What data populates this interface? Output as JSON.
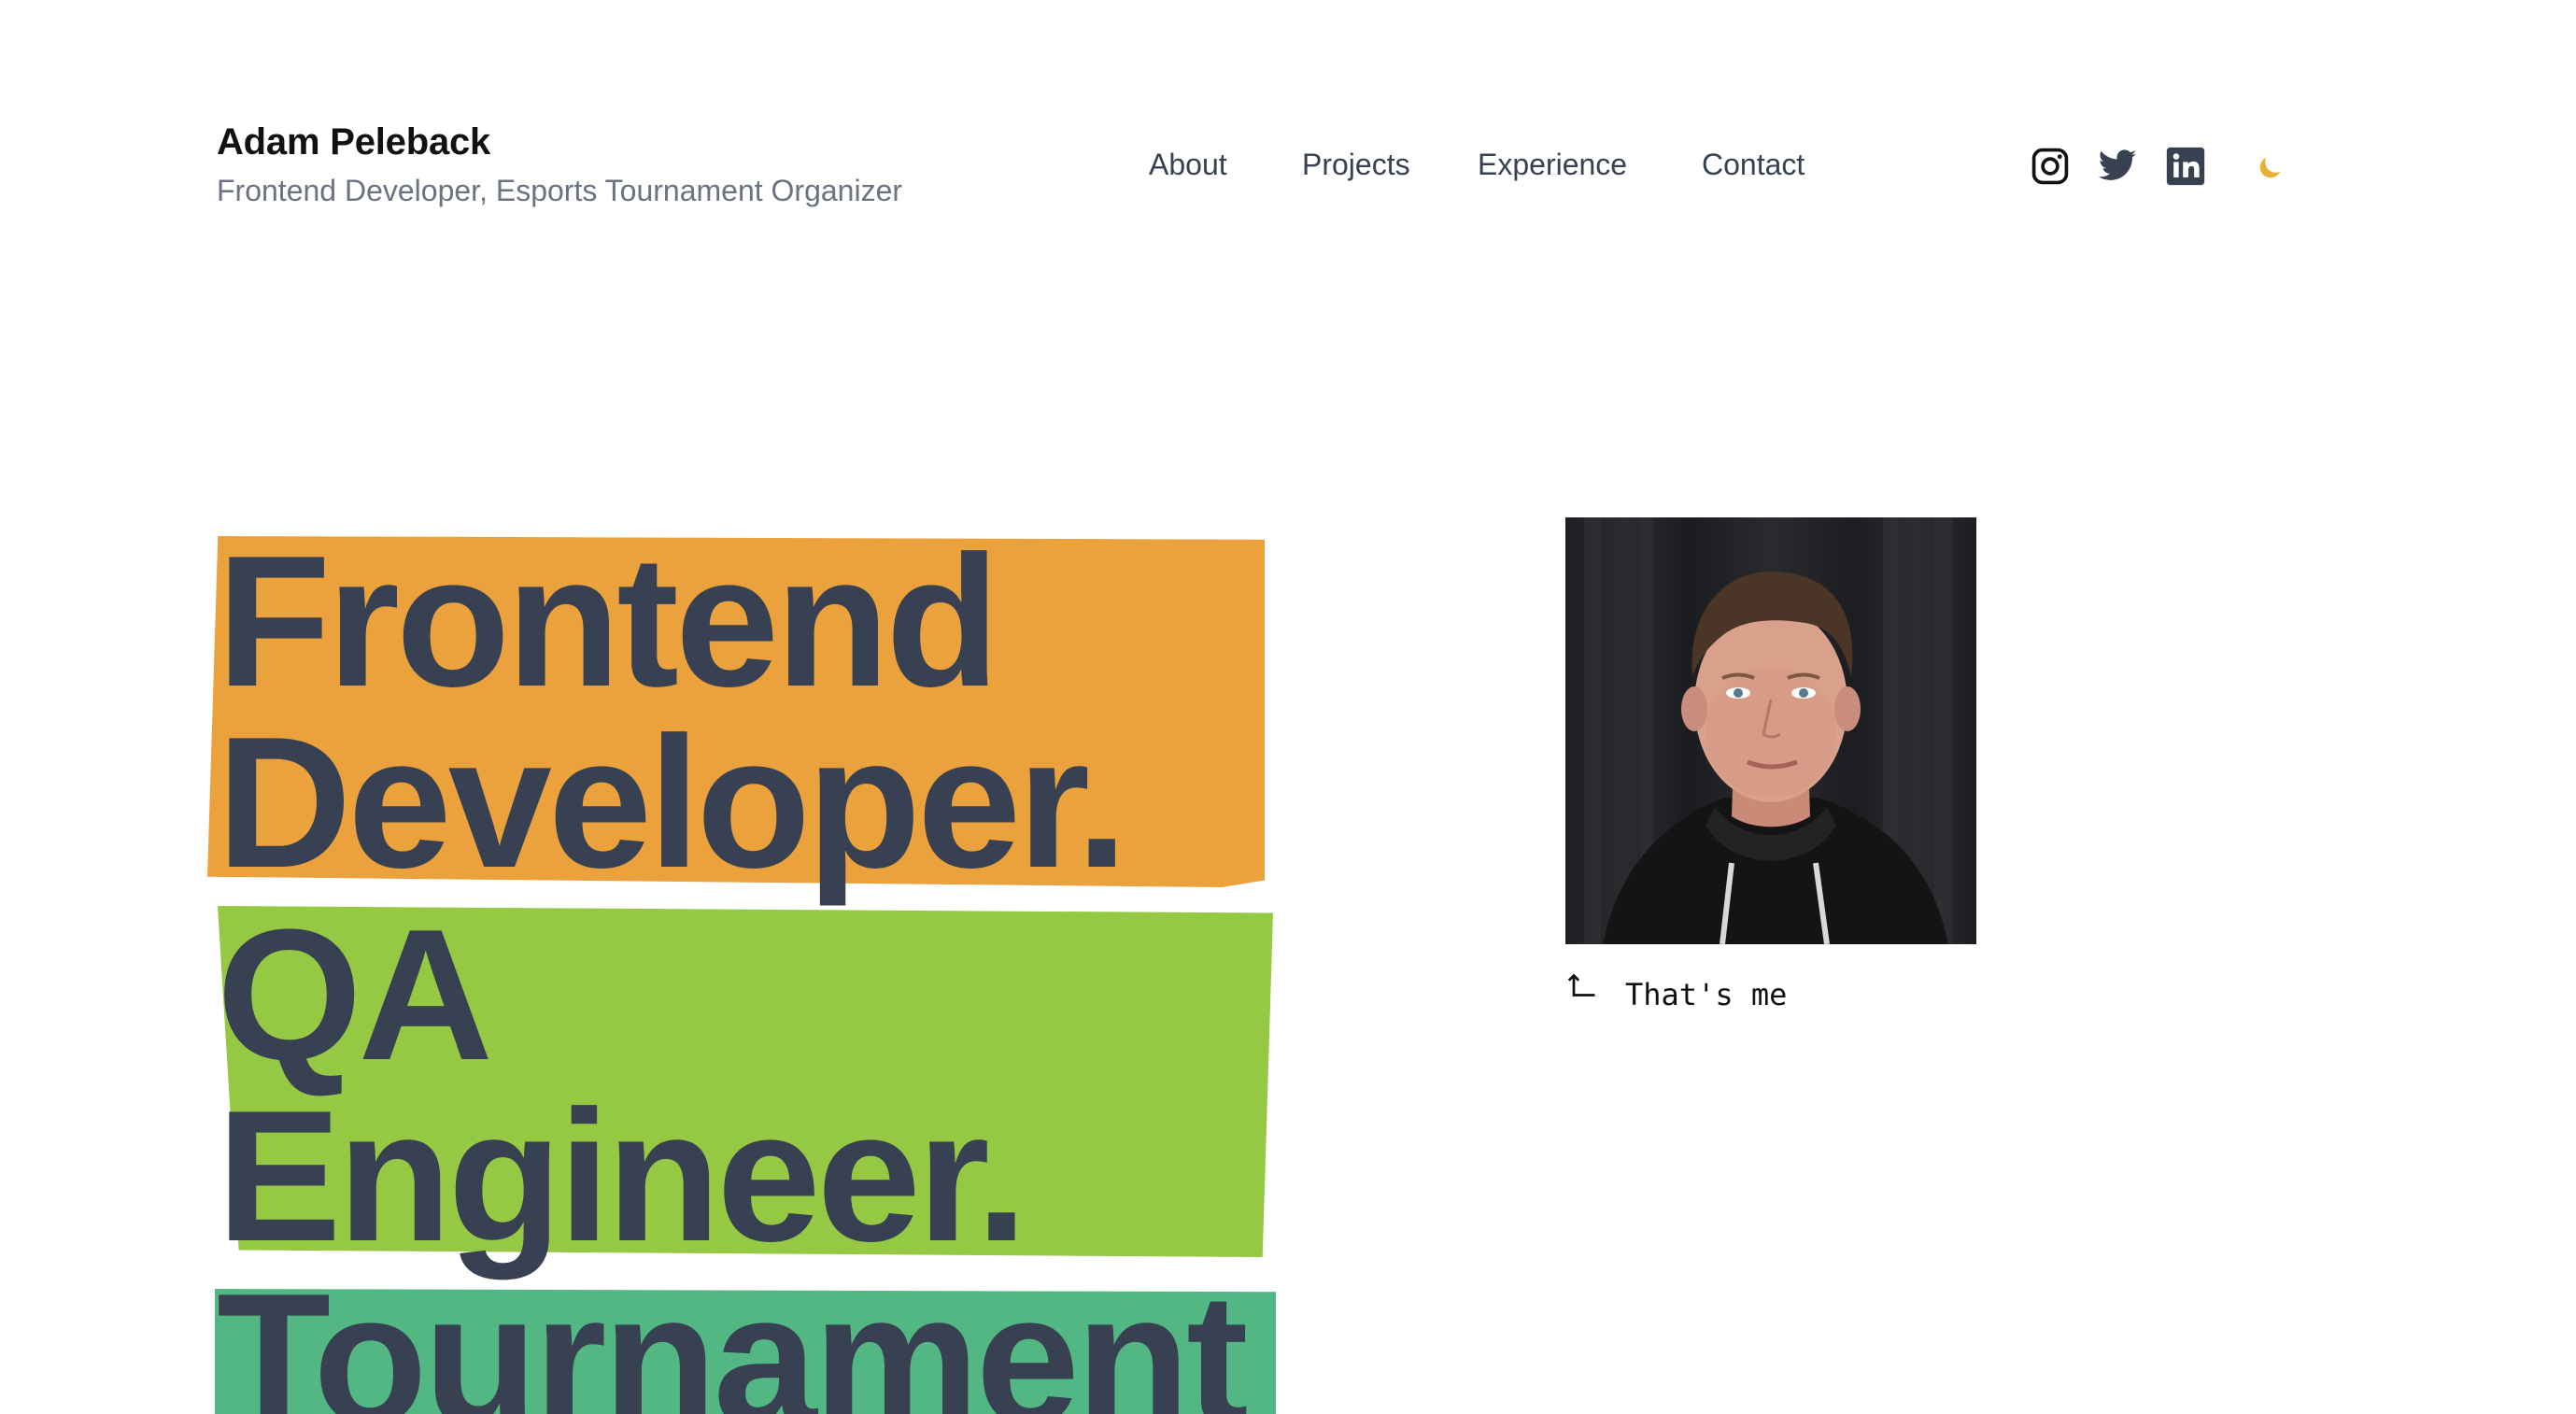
{
  "header": {
    "name": "Adam Peleback",
    "subtitle": "Frontend Developer, Esports Tournament Organizer"
  },
  "nav": {
    "items": [
      "About",
      "Projects",
      "Experience",
      "Contact"
    ]
  },
  "social": {
    "icons": [
      "instagram-icon",
      "twitter-icon",
      "linkedin-icon"
    ],
    "theme_toggle_icon": "moon-icon"
  },
  "hero": {
    "lines": [
      "Frontend",
      "Developer.",
      "QA",
      "Engineer.",
      "Tournament"
    ],
    "highlight_colors": [
      "#eba13c",
      "#95c843",
      "#53b784"
    ],
    "text_color": "#374151"
  },
  "portrait": {
    "caption": "That's me",
    "caption_icon": "corner-up-arrow-icon"
  },
  "colors": {
    "accent_moon": "#e8b132",
    "subtitle_gray": "#6b7280"
  }
}
